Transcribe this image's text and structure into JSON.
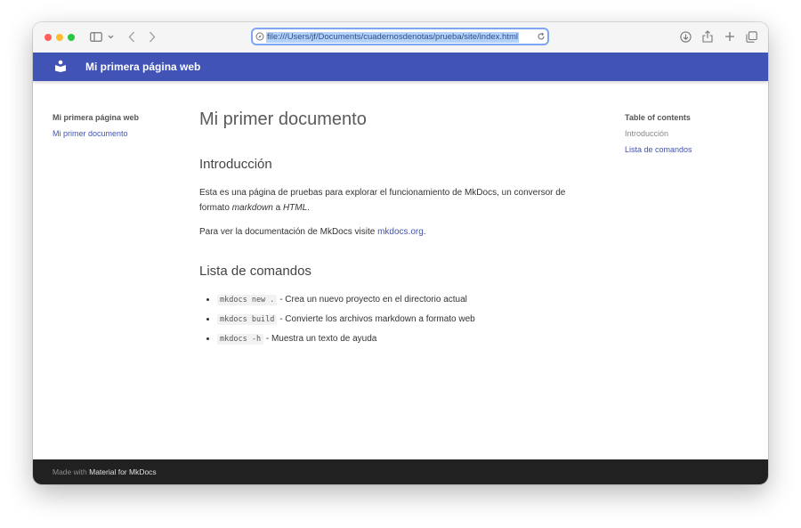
{
  "browser": {
    "url": "file:///Users/jf/Documents/cuadernosdenotas/prueba/site/index.html"
  },
  "site": {
    "title": "Mi primera página web"
  },
  "nav": {
    "title": "Mi primera página web",
    "items": [
      {
        "label": "Mi primer documento"
      }
    ]
  },
  "page": {
    "title": "Mi primer documento",
    "intro_heading": "Introducción",
    "intro_p1_a": "Esta es una página de pruebas para explorar el funcionamiento de MkDocs, un conversor de formato ",
    "intro_p1_em1": "markdown",
    "intro_p1_b": " a ",
    "intro_p1_em2": "HTML",
    "intro_p1_c": ".",
    "intro_p2_a": "Para ver la documentación de MkDocs visite ",
    "intro_p2_link": "mkdocs.org",
    "intro_p2_b": ".",
    "commands_heading": "Lista de comandos",
    "commands": [
      {
        "code": "mkdocs new .",
        "text": " - Crea un nuevo proyecto en el directorio actual"
      },
      {
        "code": "mkdocs build",
        "text": " - Convierte los archivos markdown a formato web"
      },
      {
        "code": "mkdocs -h",
        "text": " - Muestra un texto de ayuda"
      }
    ]
  },
  "toc": {
    "title": "Table of contents",
    "items": [
      {
        "label": "Introducción"
      },
      {
        "label": "Lista de comandos"
      }
    ]
  },
  "footer": {
    "prefix": "Made with ",
    "link": "Material for MkDocs"
  },
  "colors": {
    "header": "#4153b5",
    "link": "#4153b5",
    "footer": "#212121",
    "traffic_red": "#ff5f57",
    "traffic_yellow": "#febc2e",
    "traffic_green": "#28c840"
  }
}
